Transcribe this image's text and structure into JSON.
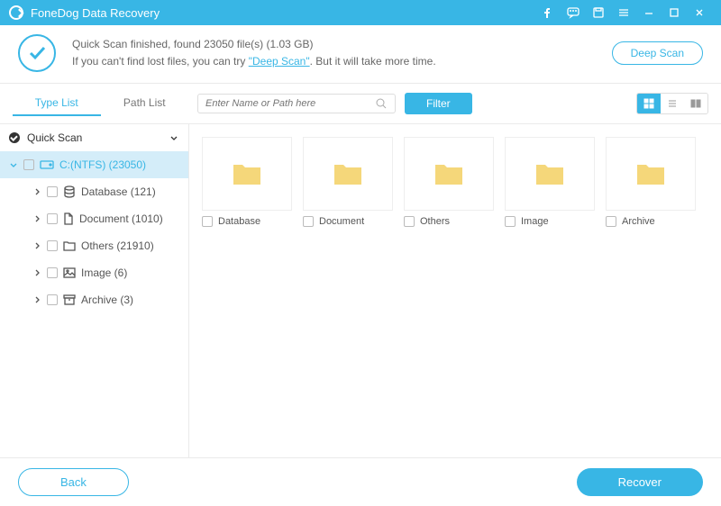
{
  "app_title": "FoneDog Data Recovery",
  "status": {
    "line1_a": "Quick Scan finished, found ",
    "count": "23050",
    "line1_b": " file(s) ",
    "size": "(1.03 GB)",
    "line2_a": "If you can't find lost files, you can try ",
    "link": "\"Deep Scan\"",
    "line2_b": ". But it will take more time.",
    "deep_scan_btn": "Deep Scan"
  },
  "tabs": {
    "type_list": "Type List",
    "path_list": "Path List"
  },
  "search": {
    "placeholder": "Enter Name or Path here"
  },
  "filter_btn": "Filter",
  "tree": {
    "root": "Quick Scan",
    "drive": "C:(NTFS) (23050)",
    "items": [
      {
        "label": "Database (121)"
      },
      {
        "label": "Document (1010)"
      },
      {
        "label": "Others (21910)"
      },
      {
        "label": "Image (6)"
      },
      {
        "label": "Archive (3)"
      }
    ]
  },
  "grid": {
    "folders": [
      {
        "label": "Database"
      },
      {
        "label": "Document"
      },
      {
        "label": "Others"
      },
      {
        "label": "Image"
      },
      {
        "label": "Archive"
      }
    ]
  },
  "footer": {
    "back": "Back",
    "recover": "Recover"
  }
}
